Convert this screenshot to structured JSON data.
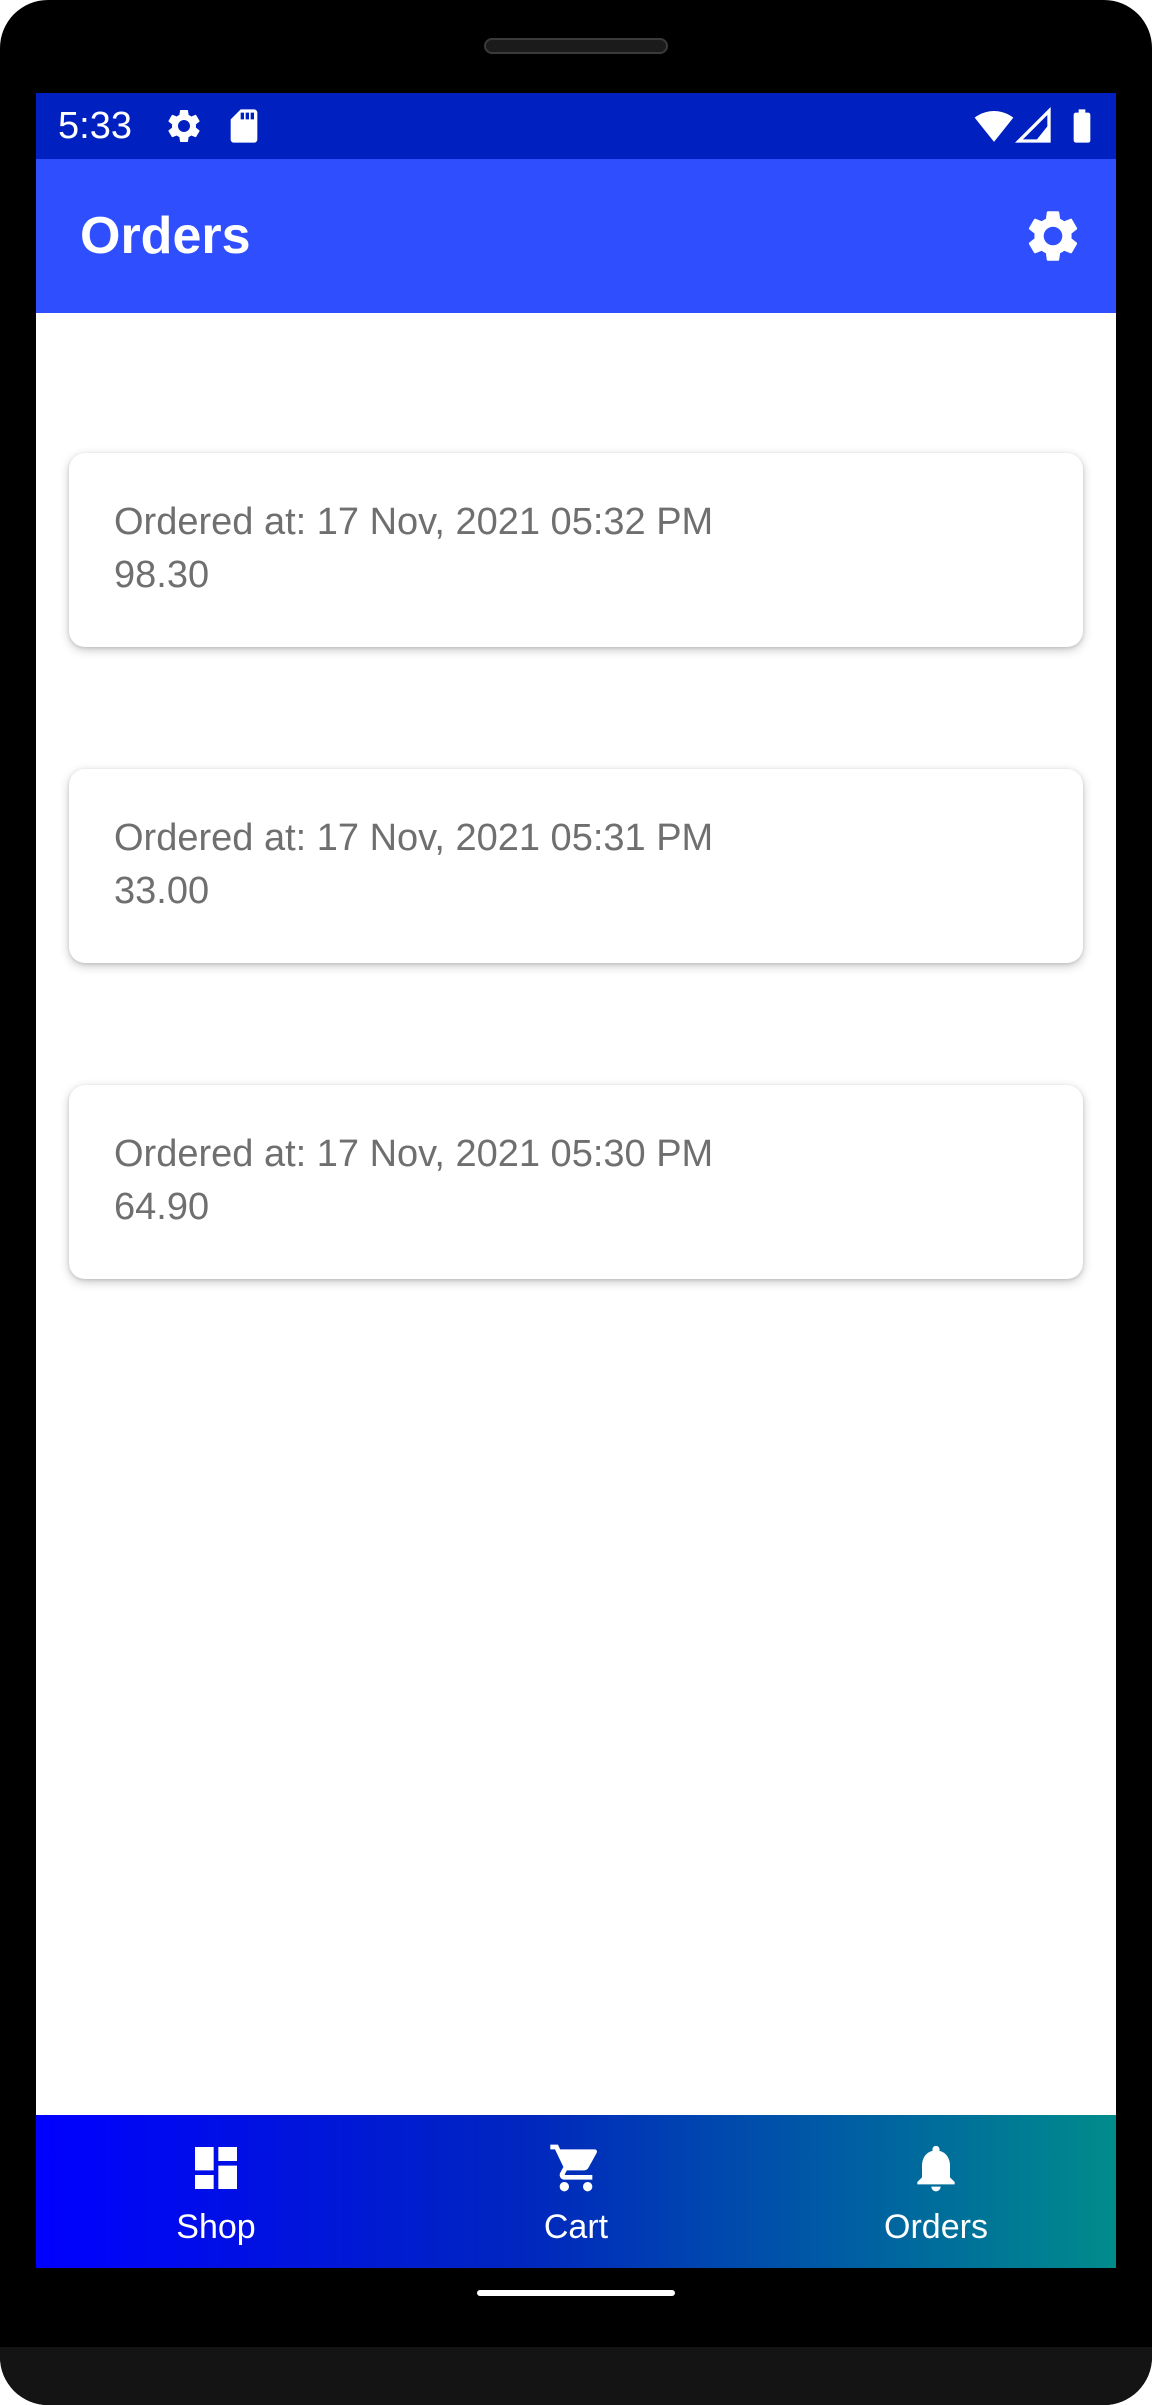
{
  "status_bar": {
    "time": "5:33",
    "left_icons": [
      "gear-icon",
      "sd-card-icon"
    ],
    "right_icons": [
      "wifi-icon",
      "signal-icon",
      "battery-icon"
    ],
    "color": "#0020c0"
  },
  "app_bar": {
    "title": "Orders",
    "action_icon": "gear-icon",
    "color": "#2f4fff"
  },
  "orders": [
    {
      "date": "Ordered at: 17 Nov, 2021 05:32 PM",
      "total": "98.30"
    },
    {
      "date": "Ordered at: 17 Nov, 2021 05:31 PM",
      "total": "33.00"
    },
    {
      "date": "Ordered at: 17 Nov, 2021 05:30 PM",
      "total": "64.90"
    }
  ],
  "bottom_nav": {
    "items": [
      {
        "label": "Shop",
        "icon": "dashboard-icon"
      },
      {
        "label": "Cart",
        "icon": "cart-icon"
      },
      {
        "label": "Orders",
        "icon": "bell-icon"
      }
    ],
    "gradient": [
      "#0000ff",
      "#0026bf",
      "#008c8c"
    ]
  }
}
